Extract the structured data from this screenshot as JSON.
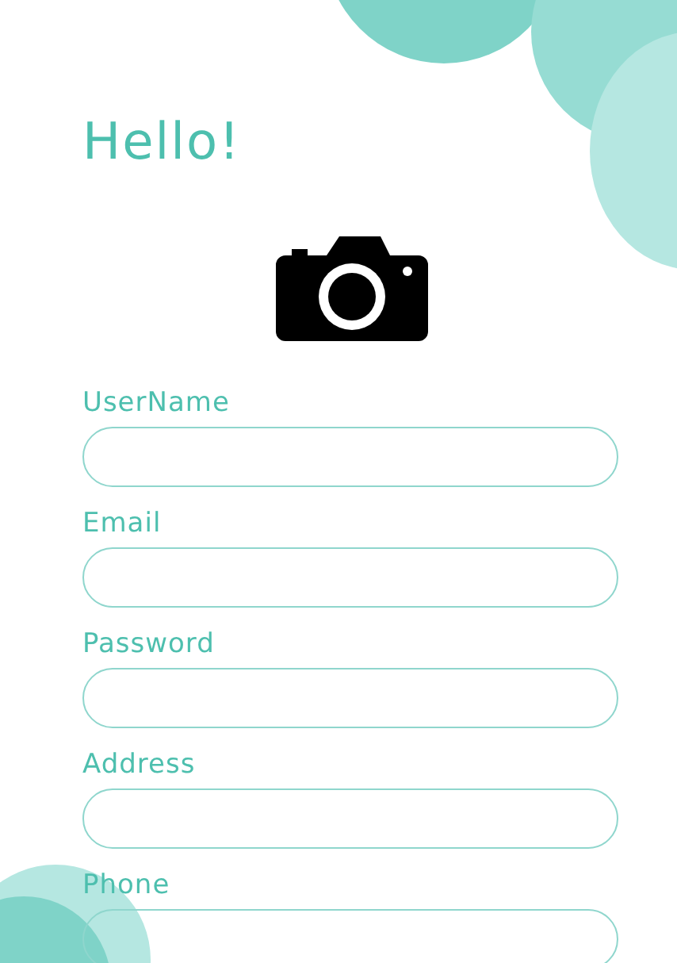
{
  "greeting": "Hello!",
  "fields": [
    {
      "label": "UserName"
    },
    {
      "label": "Email"
    },
    {
      "label": "Password"
    },
    {
      "label": "Address"
    },
    {
      "label": "Phone"
    }
  ]
}
